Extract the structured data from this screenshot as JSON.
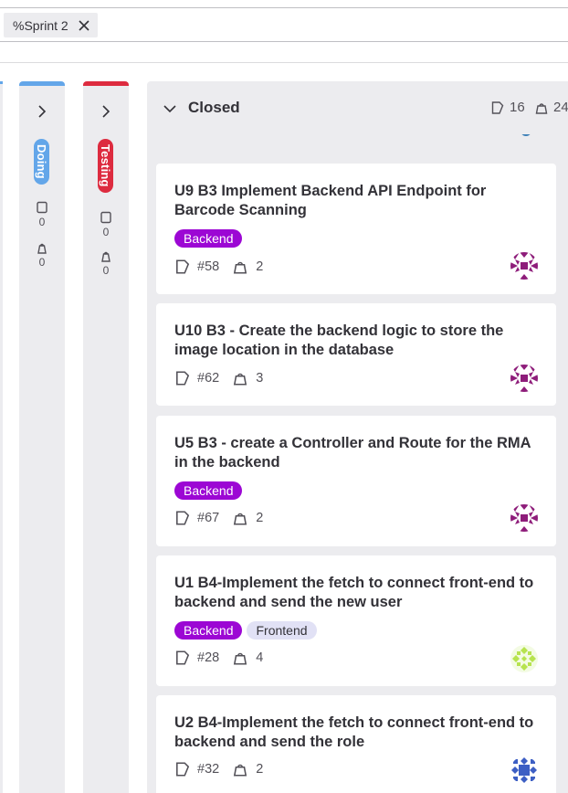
{
  "filter": {
    "token": "%Sprint 2"
  },
  "columns": {
    "doing": {
      "title": "Doing",
      "color": "#63a6e9",
      "issues": "0",
      "weight": "0"
    },
    "testing": {
      "title": "Testing",
      "color": "#dd2b3f",
      "issues": "0",
      "weight": "0"
    },
    "closed": {
      "title": "Closed",
      "issue_count": "16",
      "weight_total": "24"
    }
  },
  "labels": {
    "backend": {
      "text": "Backend",
      "bg": "#9c07d4",
      "fg": "#ffffff"
    },
    "frontend": {
      "text": "Frontend",
      "bg": "#e1e1f5",
      "fg": "#333238"
    }
  },
  "cards": [
    {
      "title": "U9 B3 Implement Backend API Endpoint for Barcode Scanning",
      "labels": [
        "Backend"
      ],
      "number": "#58",
      "weight": "2",
      "avatar": "purple-identicon"
    },
    {
      "title": "U10 B3 - Create the backend logic to store the image location in the database",
      "labels": [],
      "number": "#62",
      "weight": "3",
      "avatar": "purple-identicon"
    },
    {
      "title": "U5 B3 - create a Controller and Route for the RMA in the backend",
      "labels": [
        "Backend"
      ],
      "number": "#67",
      "weight": "2",
      "avatar": "purple-identicon"
    },
    {
      "title": "U1 B4-Implement the fetch to connect front-end to backend and send the new user",
      "labels": [
        "Backend",
        "Frontend"
      ],
      "number": "#28",
      "weight": "4",
      "avatar": "green-identicon"
    },
    {
      "title": "U2 B4-Implement the fetch to connect front-end to backend and send the role",
      "labels": [],
      "number": "#32",
      "weight": "2",
      "avatar": "blue-identicon"
    }
  ]
}
